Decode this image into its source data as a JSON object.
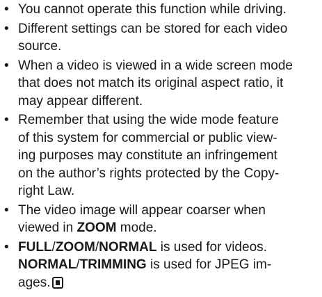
{
  "notes": [
    {
      "lines": [
        "You cannot operate this function while driving."
      ]
    },
    {
      "lines": [
        "Different settings can be stored for each video",
        "source."
      ]
    },
    {
      "lines": [
        "When a video is viewed in a wide screen mode",
        "that does not match its original aspect ratio, it",
        "may appear different."
      ]
    },
    {
      "lines": [
        "Remember that using the wide mode feature",
        "of this system for commercial or public view-",
        "ing purposes may constitute an infringement",
        "on the author’s rights protected by the Copy-",
        "right Law."
      ]
    },
    {
      "line1": "The video image will appear coarser when",
      "line2_before": "viewed in ",
      "line2_bold": "ZOOM",
      "line2_after": " mode."
    },
    {
      "full": "FULL",
      "slash1": "/",
      "zoom": "ZOOM",
      "slash2": "/",
      "normal": "NORMAL",
      "text1": " is used for videos.",
      "normal2": "NORMAL",
      "slash3": "/",
      "trimming": "TRIMMING",
      "text2": " is used for JPEG im-",
      "text3": "ages."
    }
  ],
  "bullet_char": "•",
  "end_mark_icon": "section-end-icon"
}
